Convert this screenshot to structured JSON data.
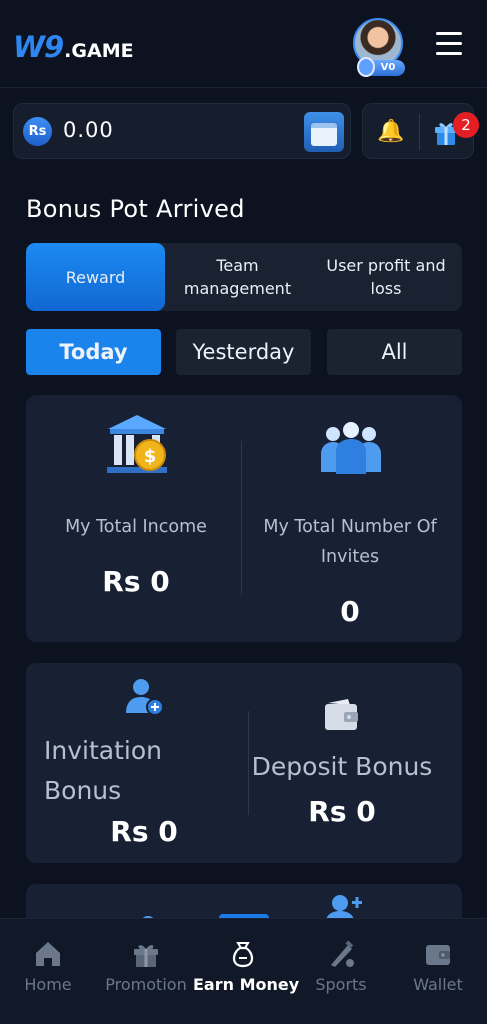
{
  "header": {
    "logo_main": "W9",
    "logo_suffix": ".GAME",
    "vip_badge": "V0",
    "icons": [
      "avatar-icon",
      "menu-icon"
    ]
  },
  "balance": {
    "currency_symbol": "Rs",
    "amount": "0.00",
    "icons": [
      "wallet-icon",
      "bell-icon",
      "gift-icon"
    ],
    "notification_count": "2"
  },
  "page": {
    "title": "Bonus Pot Arrived"
  },
  "tabs": [
    {
      "label": "Reward",
      "active": true
    },
    {
      "label": "Team management",
      "active": false
    },
    {
      "label": "User profit and loss",
      "active": false
    }
  ],
  "filters": [
    {
      "label": "Today",
      "active": true
    },
    {
      "label": "Yesterday",
      "active": false
    },
    {
      "label": "All",
      "active": false
    }
  ],
  "stats": {
    "total_income_label": "My Total Income",
    "total_income_value": "Rs 0",
    "total_invites_label": "My Total Number Of Invites",
    "total_invites_value": "0",
    "invitation_bonus_label": "Invitation Bonus",
    "invitation_bonus_value": "Rs 0",
    "deposit_bonus_label": "Deposit Bonus",
    "deposit_bonus_value": "Rs 0"
  },
  "bottom_nav": [
    {
      "label": "Home",
      "icon": "home-icon",
      "active": false
    },
    {
      "label": "Promotion",
      "icon": "gift-icon",
      "active": false
    },
    {
      "label": "Earn Money",
      "icon": "money-bag-icon",
      "active": true
    },
    {
      "label": "Sports",
      "icon": "sports-icon",
      "active": false
    },
    {
      "label": "Wallet",
      "icon": "wallet-icon",
      "active": false
    }
  ],
  "colors": {
    "background": "#0c1220",
    "card": "#172133",
    "accent": "#1a83ec",
    "badge": "#e41f24"
  }
}
